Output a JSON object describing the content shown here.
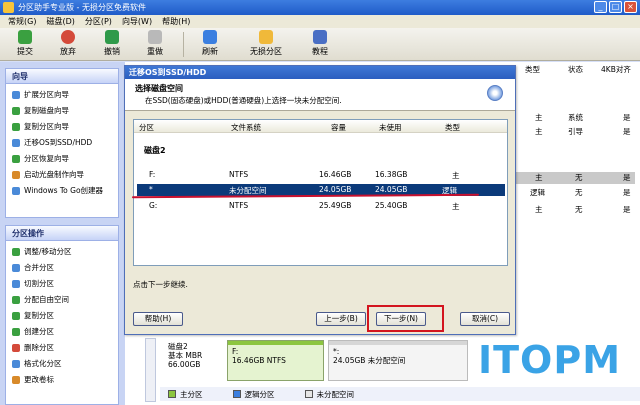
{
  "window": {
    "title": "分区助手专业版 - 无损分区免费软件",
    "buttons": [
      "_",
      "□",
      "×"
    ]
  },
  "menu": [
    "常规(G)",
    "磁盘(D)",
    "分区(P)",
    "向导(W)",
    "帮助(H)"
  ],
  "toolbar": [
    "提交",
    "放弃",
    "撤销",
    "重做",
    "刷新",
    "无损分区",
    "教程"
  ],
  "sidebar": {
    "wizard": {
      "title": "向导",
      "items": [
        "扩展分区向导",
        "复制磁盘向导",
        "复制分区向导",
        "迁移OS到SSD/HDD",
        "分区恢复向导",
        "启动光盘制作向导",
        "Windows To Go创建器"
      ]
    },
    "ops": {
      "title": "分区操作",
      "items": [
        "调整/移动分区",
        "合并分区",
        "切割分区",
        "分配自由空间",
        "复制分区",
        "创建分区",
        "删除分区",
        "格式化分区",
        "更改卷标"
      ]
    }
  },
  "right_panel": {
    "headers": [
      "类型",
      "状态",
      "4KB对齐"
    ],
    "rows": [
      {
        "type": "主",
        "status": "系统",
        "align": "是"
      },
      {
        "type": "主",
        "status": "引导",
        "align": "是"
      },
      {
        "type": "主",
        "status": "无",
        "align": "是"
      },
      {
        "type": "逻辑",
        "status": "无",
        "align": "是"
      },
      {
        "type": "主",
        "status": "无",
        "align": "是"
      }
    ]
  },
  "dialog": {
    "title": "迁移OS到SSD/HDD",
    "heading": "选择磁盘空间",
    "subheading": "在SSD(固态硬盘)或HDD(普通硬盘)上选择一块未分配空间.",
    "columns": [
      "分区",
      "文件系统",
      "容量",
      "未使用",
      "类型"
    ],
    "group": "磁盘2",
    "rows": [
      {
        "part": "F:",
        "fs": "NTFS",
        "cap": "16.46GB",
        "free": "16.38GB",
        "type": "主"
      },
      {
        "part": "*",
        "fs": "未分配空间",
        "cap": "24.05GB",
        "free": "24.05GB",
        "type": "逻辑"
      },
      {
        "part": "G:",
        "fs": "NTFS",
        "cap": "25.49GB",
        "free": "25.40GB",
        "type": "主"
      }
    ],
    "status": "点击下一步继续.",
    "buttons": {
      "help": "帮助(H)",
      "back": "上一步(B)",
      "next": "下一步(N)",
      "cancel": "取消(C)"
    }
  },
  "diskmap": {
    "disk": "磁盘2",
    "kind": "基本 MBR",
    "size": "66.00GB",
    "segments": [
      {
        "label": "F:",
        "detail": "16.46GB NTFS"
      },
      {
        "label": "*:",
        "detail": "24.05GB 未分配空间"
      }
    ]
  },
  "legend": [
    "主分区",
    "逻辑分区",
    "未分配空间"
  ],
  "colors": {
    "primary": "#8cc63f",
    "logical": "#3b7fe0",
    "unallocated": "#e6e6e6",
    "highlight": "#d3151f",
    "logo": "#3aa3e6"
  },
  "logo": "ITOPM"
}
